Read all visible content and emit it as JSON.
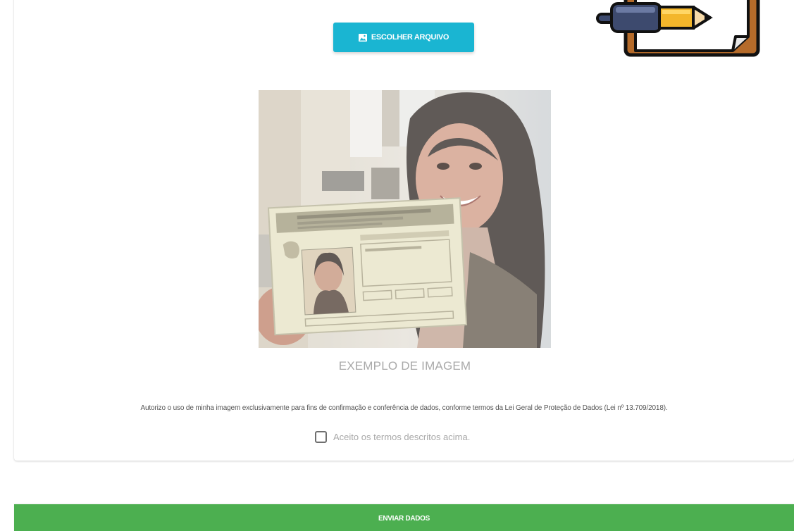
{
  "upload": {
    "button_label": "ESCOLHER ARQUIVO",
    "button_icon": "image-icon",
    "button_color": "#1ab5d2"
  },
  "decoration": {
    "icon": "clipboard-pen-icon"
  },
  "example": {
    "caption": "EXEMPLO DE IMAGEM"
  },
  "consent": {
    "text": "Autorizo o uso de minha imagem exclusivamente para fins de confirmação e conferência de dados, conforme termos da Lei Geral de Proteção de Dados (Lei nº 13.709/2018).",
    "checkbox_label": "Aceito os termos descritos acima.",
    "checked": false
  },
  "submit": {
    "label": "ENVIAR DADOS",
    "color": "#4caf50"
  }
}
